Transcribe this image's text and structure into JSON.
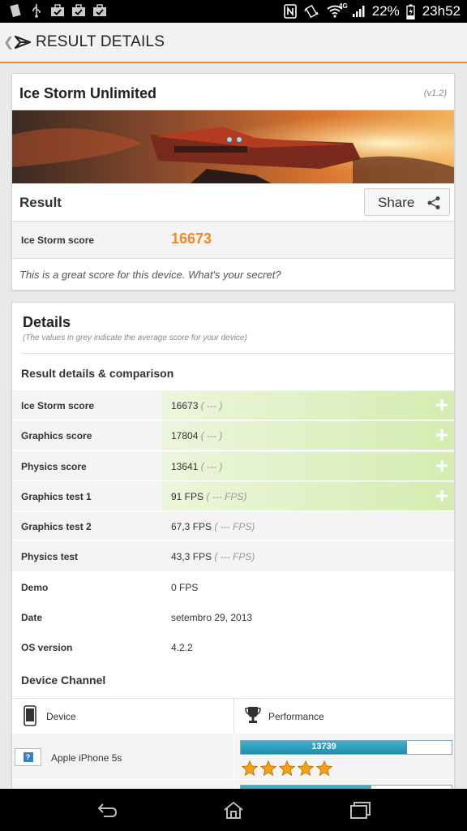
{
  "status_bar": {
    "battery_percent": "22%",
    "time": "23h52",
    "network": "4G",
    "left_icons": [
      "sd-card-icon",
      "usb-icon",
      "briefcase-check-icon",
      "briefcase-check-icon",
      "briefcase-check-icon"
    ],
    "right_icons": [
      "nfc-icon",
      "vibrate-icon",
      "wifi-icon",
      "signal-icon",
      "battery-charging-icon"
    ]
  },
  "action_bar": {
    "title": "RESULT DETAILS",
    "accent_color": "#f08a24"
  },
  "benchmark_card": {
    "title": "Ice Storm Unlimited",
    "version": "(v1.2)",
    "result_label": "Result",
    "share_label": "Share",
    "score_label": "Ice Storm score",
    "score_value": "16673",
    "message": "This is a great score for this device. What's your secret?"
  },
  "details": {
    "title": "Details",
    "subtitle": "(The values in grey indicate the average score for your device)",
    "section_title": "Result details & comparison",
    "rows": [
      {
        "label": "Ice Storm score",
        "value": "16673",
        "avg": "( --- )",
        "expandable": true
      },
      {
        "label": "Graphics score",
        "value": "17804",
        "avg": "( --- )",
        "expandable": true
      },
      {
        "label": "Physics score",
        "value": "13641",
        "avg": "( --- )",
        "expandable": true
      },
      {
        "label": "Graphics test 1",
        "value": "91 FPS",
        "avg": "( --- FPS)",
        "expandable": true
      },
      {
        "label": "Graphics test 2",
        "value": "67,3 FPS",
        "avg": "( --- FPS)",
        "expandable": false
      },
      {
        "label": "Physics test",
        "value": "43,3 FPS",
        "avg": "( --- FPS)",
        "expandable": false
      },
      {
        "label": "Demo",
        "value": "0 FPS",
        "avg": "",
        "expandable": false
      },
      {
        "label": "Date",
        "value": "setembro 29, 2013",
        "avg": "",
        "expandable": false
      },
      {
        "label": "OS version",
        "value": "4.2.2",
        "avg": "",
        "expandable": false
      }
    ]
  },
  "device_channel": {
    "title": "Device Channel",
    "col_device": "Device",
    "col_performance": "Performance",
    "devices": [
      {
        "name": "Apple iPhone 5s",
        "score": "13739",
        "bar_fraction": 0.79,
        "stars": 5
      },
      {
        "name": "",
        "score": "",
        "bar_fraction": 0.62,
        "stars": 0
      }
    ]
  },
  "nav_bar": {
    "icons": [
      "back-icon",
      "home-icon",
      "recent-apps-icon"
    ]
  }
}
